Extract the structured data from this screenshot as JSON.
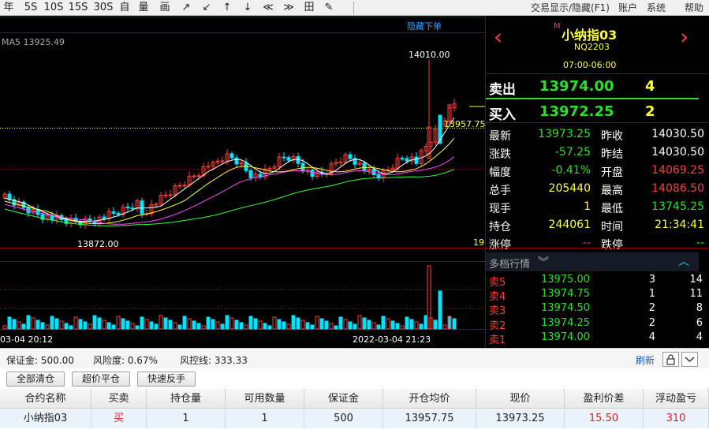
{
  "toolbar": {
    "buttons": [
      "年",
      "5S",
      "10S",
      "15S",
      "30S",
      "自",
      "量",
      "画",
      "↗",
      "↙",
      "↑",
      "↓",
      "≪",
      "≫",
      "田",
      "✎"
    ],
    "menus": [
      "交易显示/隐藏(F1)",
      "账户",
      "系统",
      "帮助"
    ]
  },
  "chart": {
    "ma_label": "MA5 13925.49",
    "hide_label": "隐藏下单",
    "high_label": "14010.00",
    "low_label": "13872.00",
    "price_line_label": "13957.75",
    "count_label": "19",
    "time_left": "03-04 20:12",
    "time_right": "2022-03-04 21:23",
    "colors": {
      "up": "#ff3b3b",
      "down": "#00e5ff",
      "ma5": "#ffffff",
      "ma10": "#ffff33",
      "ma20": "#ff44ff",
      "ma60": "#33ff33"
    }
  },
  "panel": {
    "title_mark": "M",
    "title": "小纳指03",
    "code": "NQ2203",
    "session": "07:00-06:00",
    "ask": {
      "label": "卖出",
      "price": "13974.00",
      "qty": "4"
    },
    "bid": {
      "label": "买入",
      "price": "13972.25",
      "qty": "2"
    },
    "stats": [
      {
        "l1": "最新",
        "v1": "13973.25",
        "c1": "green",
        "l2": "昨收",
        "v2": "14030.50",
        "c2": "white"
      },
      {
        "l1": "涨跌",
        "v1": "-57.25",
        "c1": "green",
        "l2": "昨结",
        "v2": "14030.50",
        "c2": "white"
      },
      {
        "l1": "幅度",
        "v1": "-0.41%",
        "c1": "green",
        "l2": "开盘",
        "v2": "14069.25",
        "c2": "red"
      },
      {
        "l1": "总手",
        "v1": "205440",
        "c1": "yellow",
        "l2": "最高",
        "v2": "14086.50",
        "c2": "red"
      },
      {
        "l1": "现手",
        "v1": "1",
        "c1": "yellow",
        "l2": "最低",
        "v2": "13745.25",
        "c2": "green"
      },
      {
        "l1": "持仓",
        "v1": "244061",
        "c1": "yellow",
        "l2": "时间",
        "v2": "21:34:41",
        "c2": "yellow"
      },
      {
        "l1": "涨停",
        "v1": "--",
        "c1": "red",
        "l2": "跌停",
        "v2": "--",
        "c2": "green"
      }
    ],
    "depth_title": "多档行情",
    "depth_icon": "double-chevron-down-icon",
    "depth": [
      {
        "label": "卖5",
        "price": "13975.00",
        "qty": "3",
        "total": "14"
      },
      {
        "label": "卖4",
        "price": "13974.75",
        "qty": "1",
        "total": "11"
      },
      {
        "label": "卖3",
        "price": "13974.50",
        "qty": "2",
        "total": "8"
      },
      {
        "label": "卖2",
        "price": "13974.25",
        "qty": "2",
        "total": "6"
      },
      {
        "label": "卖1",
        "price": "13974.00",
        "qty": "4",
        "total": "4"
      }
    ]
  },
  "status": {
    "margin": "保证金: 500.00",
    "risk": "风险度: 0.67%",
    "control": "风控线: 333.33",
    "refresh": "刷新"
  },
  "actions": [
    "全部清仓",
    "超价平仓",
    "快速反手"
  ],
  "positions": {
    "headers": [
      "合约名称",
      "买卖",
      "持仓量",
      "可用数量",
      "保证金",
      "开仓均价",
      "现价",
      "盈利价差",
      "浮动盈亏"
    ],
    "rows": [
      [
        "小纳指03",
        "买",
        "1",
        "1",
        "500",
        "13957.75",
        "13973.25",
        "15.50",
        "310"
      ]
    ]
  }
}
